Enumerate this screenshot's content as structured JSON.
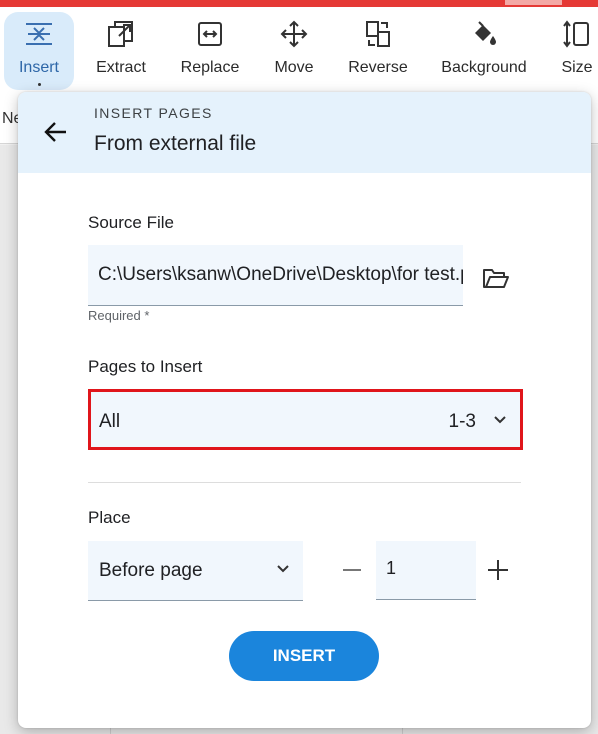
{
  "toolbar": {
    "items": [
      {
        "label": "Insert",
        "icon": "insert-icon",
        "active": true
      },
      {
        "label": "Extract",
        "icon": "extract-icon"
      },
      {
        "label": "Replace",
        "icon": "replace-icon"
      },
      {
        "label": "Move",
        "icon": "move-icon"
      },
      {
        "label": "Reverse",
        "icon": "reverse-icon"
      },
      {
        "label": "Background",
        "icon": "paint-bucket-icon"
      },
      {
        "label": "Size",
        "icon": "size-icon"
      }
    ]
  },
  "background": {
    "truncated_label": "Ne"
  },
  "dialog": {
    "kicker": "INSERT PAGES",
    "title": "From external file",
    "source_file": {
      "label": "Source File",
      "value": "C:\\Users\\ksanw\\OneDrive\\Desktop\\for test.pdf",
      "hint": "Required *"
    },
    "pages_to_insert": {
      "label": "Pages to Insert",
      "value": "All",
      "range": "1-3"
    },
    "place": {
      "label": "Place",
      "value": "Before page",
      "page_number": "1"
    },
    "insert_button": "INSERT"
  },
  "colors": {
    "accent": "#1b85dc",
    "header_bg": "#e5f2fc",
    "highlight_border": "#e0151b",
    "top_bar": "#e53935"
  }
}
